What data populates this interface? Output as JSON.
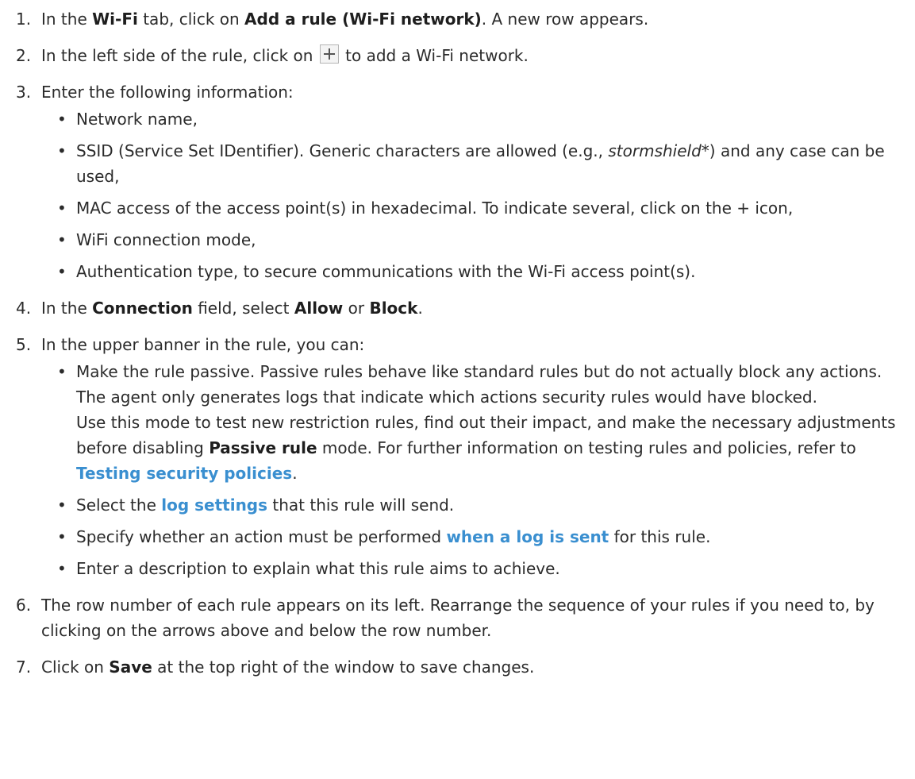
{
  "steps": [
    {
      "num": "1.",
      "a": "In the ",
      "b1": "Wi-Fi",
      "c": " tab, click on ",
      "b2": "Add a rule (Wi-Fi network)",
      "d": ". A new row appears."
    },
    {
      "num": "2.",
      "a": "In the left side of the rule, click on ",
      "icon": "plus-icon",
      "b": " to add a Wi-Fi network."
    },
    {
      "num": "3.",
      "text": "Enter the following information:",
      "bullets": {
        "network_name": "Network name,",
        "ssid_a": "SSID (Service Set IDentifier). Generic characters are allowed (e.g., ",
        "ssid_italic": "stormshield*",
        "ssid_b": ") and any case can be used,",
        "mac": "MAC access of the access point(s) in hexadecimal. To indicate several, click on the + icon,",
        "wifi_mode": "WiFi connection mode,",
        "auth": "Authentication type, to secure communications with the Wi-Fi access point(s)."
      }
    },
    {
      "num": "4.",
      "a": "In the ",
      "b1": "Connection",
      "c": " field, select ",
      "b2": "Allow",
      "d": " or ",
      "b3": "Block",
      "e": "."
    },
    {
      "num": "5.",
      "text": "In the upper banner in the rule, you can:",
      "bullets": {
        "passive_a": "Make the rule passive. Passive rules behave like standard rules but do not actually block any actions. The agent only generates logs that indicate which actions security rules would have blocked.",
        "passive_b": "Use this mode to test new restriction rules, find out their impact, and make the necessary adjustments before disabling ",
        "passive_bold": "Passive rule",
        "passive_c": " mode. For further information on testing rules and policies, refer to ",
        "passive_link": "Testing security policies",
        "passive_d": ".",
        "log_a": "Select the ",
        "log_link": "log settings",
        "log_b": " that this rule will send.",
        "action_a": "Specify whether an action must be performed ",
        "action_link": "when a log is sent",
        "action_b": " for this rule.",
        "desc": "Enter a description to explain what this rule aims to achieve."
      }
    },
    {
      "num": "6.",
      "text": "The row number of each rule appears on its left. Rearrange the sequence of your rules if you need to, by clicking on the arrows above and below the row number."
    },
    {
      "num": "7.",
      "a": "Click on ",
      "b": "Save",
      "c": " at the top right of the window to save changes."
    }
  ]
}
